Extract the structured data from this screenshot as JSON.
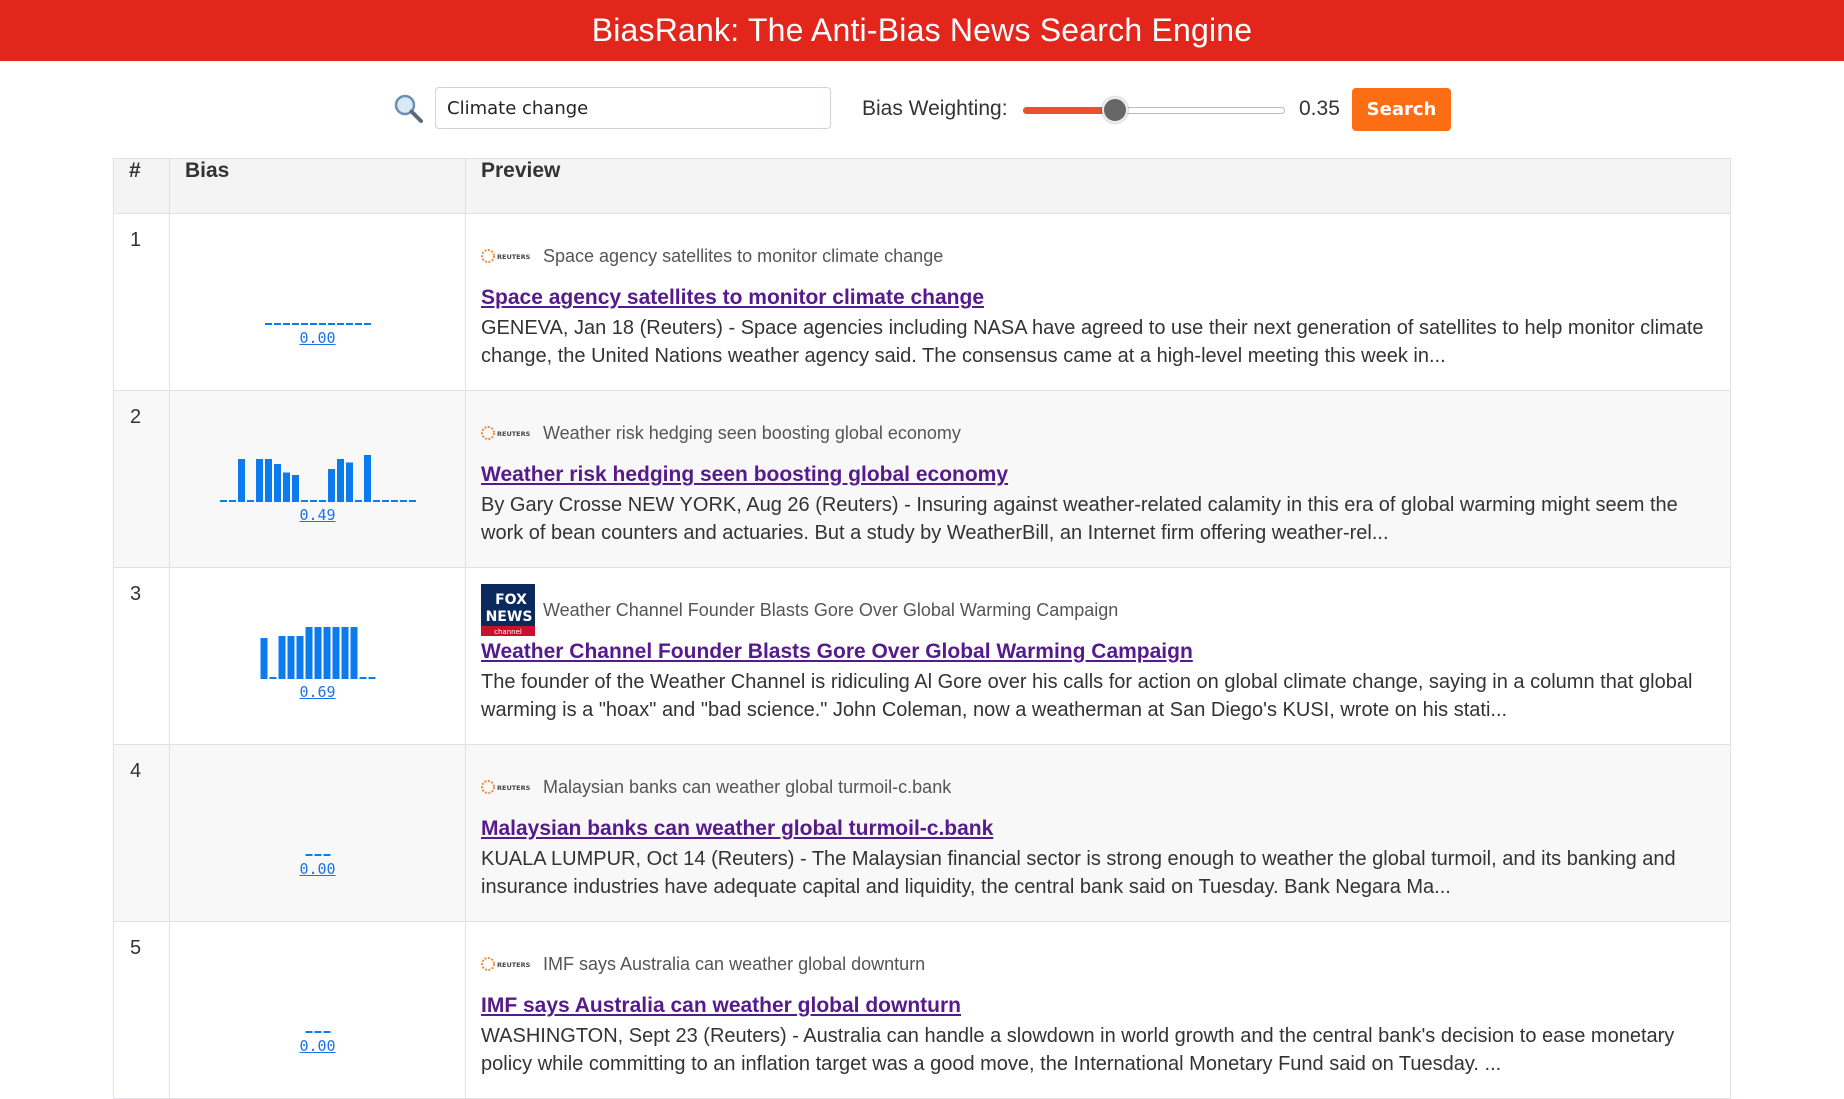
{
  "header": {
    "title": "BiasRank: The Anti-Bias News Search Engine"
  },
  "search": {
    "value": "Climate change",
    "placeholder": ""
  },
  "bias_weighting": {
    "label": "Bias Weighting:",
    "value": 0.35,
    "value_text": "0.35"
  },
  "search_button": {
    "label": "Search"
  },
  "table": {
    "headers": {
      "num": "#",
      "bias": "Bias",
      "preview": "Preview"
    },
    "rows": [
      {
        "num": "1",
        "bias_score": "0.00",
        "bias_bars": [
          0,
          0,
          0,
          0,
          0,
          0,
          0,
          0,
          0,
          0,
          0,
          0
        ],
        "source": "reuters",
        "source_title": "Space agency satellites to monitor climate change",
        "title": "Space agency satellites to monitor climate change",
        "snippet": "GENEVA, Jan 18 (Reuters) - Space agencies including NASA have agreed to use their next generation of satellites to help monitor climate change, the United Nations weather agency said. The consensus came at a high-level meeting this week in..."
      },
      {
        "num": "2",
        "bias_score": "0.49",
        "bias_bars": [
          0,
          0,
          0.82,
          0,
          0.82,
          0.82,
          0.72,
          0.55,
          0.5,
          0,
          0,
          0,
          0.62,
          0.82,
          0.75,
          0,
          0.9,
          0,
          0,
          0,
          0,
          0
        ],
        "source": "reuters",
        "source_title": "Weather risk hedging seen boosting global economy",
        "title": "Weather risk hedging seen boosting global economy",
        "snippet": "By Gary Crosse NEW YORK, Aug 26 (Reuters) - Insuring against weather-related calamity in this era of global warming might seem the work of bean counters and actuaries. But a study by WeatherBill, an Internet firm offering weather-rel..."
      },
      {
        "num": "3",
        "bias_score": "0.69",
        "bias_bars": [
          0.78,
          0,
          0.82,
          0.82,
          0.82,
          1,
          1,
          1,
          1,
          1,
          1,
          0,
          0
        ],
        "source": "foxnews",
        "source_title": "Weather Channel Founder Blasts Gore Over Global Warming Campaign",
        "title": "Weather Channel Founder Blasts Gore Over Global Warming Campaign",
        "snippet": "The founder of the Weather Channel is ridiculing Al Gore over his calls for action on global climate change, saying in a column that global warming is a \"hoax\" and \"bad science.\" John Coleman, now a weatherman at San Diego's KUSI, wrote on his stati..."
      },
      {
        "num": "4",
        "bias_score": "0.00",
        "bias_bars": [
          0,
          0,
          0
        ],
        "source": "reuters",
        "source_title": "Malaysian banks can weather global turmoil-c.bank",
        "title": "Malaysian banks can weather global turmoil-c.bank",
        "snippet": "KUALA LUMPUR, Oct 14 (Reuters) - The Malaysian financial sector is strong enough to weather the global turmoil, and its banking and insurance industries have adequate capital and liquidity, the central bank said on Tuesday. Bank Negara Ma..."
      },
      {
        "num": "5",
        "bias_score": "0.00",
        "bias_bars": [
          0,
          0,
          0
        ],
        "source": "reuters",
        "source_title": "IMF says Australia can weather global downturn",
        "title": "IMF says Australia can weather global downturn",
        "snippet": "WASHINGTON, Sept 23 (Reuters) - Australia can handle a slowdown in world growth and the central bank's decision to ease monetary policy while committing to an inflation target was a good move, the International Monetary Fund said on Tuesday. ..."
      }
    ]
  },
  "logos": {
    "reuters_text": "REUTERS",
    "fox_line1": "FOX",
    "fox_line2": "NEWS",
    "fox_line3": "channel"
  },
  "colors": {
    "header": "#e3261c",
    "accent": "#fd6e14",
    "bar": "#0d7bf0",
    "link": "#551a8b"
  }
}
